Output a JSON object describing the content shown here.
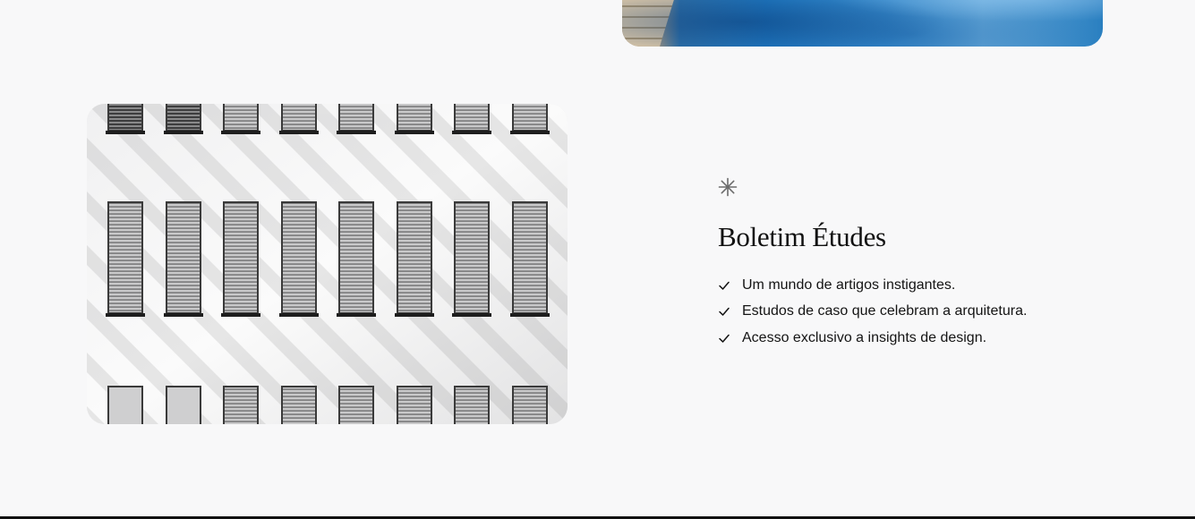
{
  "newsletter": {
    "title": "Boletim Études",
    "features": [
      "Um mundo de artigos instigantes.",
      "Estudos de caso que celebram a arquitetura.",
      "Acesso exclusivo a insights de design."
    ]
  },
  "icons": {
    "decor": "asterisk-icon",
    "feature_marker": "check-icon"
  },
  "colors": {
    "background": "#f8f8f9",
    "text": "#111111",
    "icon": "#6b6b6b"
  }
}
